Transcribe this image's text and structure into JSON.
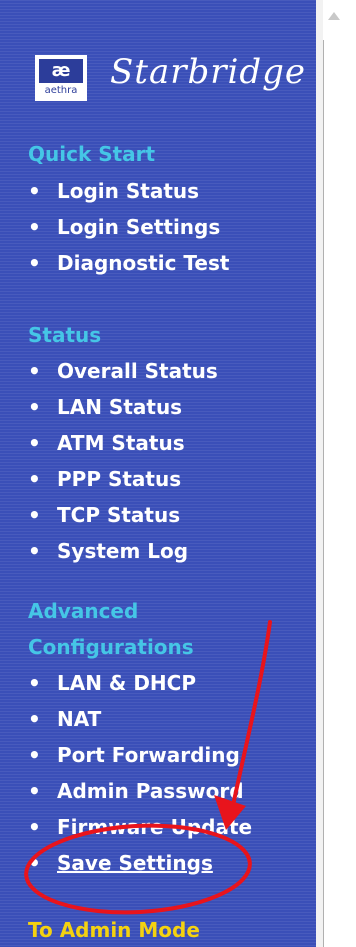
{
  "brand": {
    "name": "Starbridge",
    "logo_mark": "æ",
    "logo_word": "aethra"
  },
  "sections": [
    {
      "title": "Quick Start",
      "items": [
        "Login Status",
        "Login Settings",
        "Diagnostic Test"
      ]
    },
    {
      "title": "Status",
      "items": [
        "Overall Status",
        "LAN Status",
        "ATM Status",
        "PPP Status",
        "TCP Status",
        "System Log"
      ]
    },
    {
      "title": "Advanced Configurations",
      "title_lines": [
        "Advanced",
        "Configurations"
      ],
      "items": [
        "LAN & DHCP",
        "NAT",
        "Port Forwarding",
        "Admin Password",
        "Firmware Update",
        "Save Settings"
      ]
    }
  ],
  "footer": {
    "admin_mode": "To Admin Mode"
  },
  "bullet": "•",
  "colors": {
    "sidebar": "#3a4fb8",
    "section_title": "#45c6e6",
    "item_text": "#ffffff",
    "admin_text": "#f4d210",
    "annotation": "#e8141c"
  }
}
